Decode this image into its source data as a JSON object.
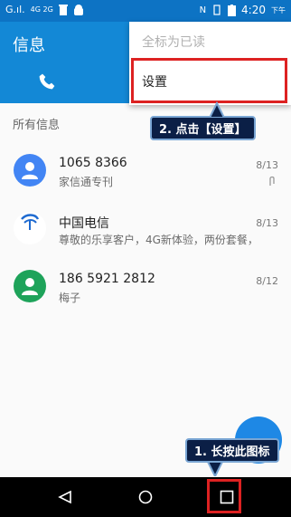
{
  "status_bar": {
    "signal_left": "G.ıl.",
    "network": "4G 2G",
    "time": "4:20",
    "ampm": "下午"
  },
  "app": {
    "title": "信息"
  },
  "section_header": "所有信息",
  "conversations": [
    {
      "name": "1065 8366",
      "preview": "家信通专刊",
      "date": "8/13",
      "avatar_color": "#4285f4",
      "has_attachment": true
    },
    {
      "name": "中国电信",
      "preview": "尊敬的乐享客户，4G新体验，两份套餐，",
      "date": "8/13",
      "avatar_logo_text": "中国电信"
    },
    {
      "name": "186 5921 2812",
      "preview": "梅子",
      "date": "8/12",
      "avatar_color": "#1ea35a"
    }
  ],
  "menu": {
    "items": [
      {
        "label": "全标为已读",
        "enabled": false
      },
      {
        "label": "设置",
        "enabled": true
      }
    ]
  },
  "annotations": {
    "step2": "2. 点击【设置】",
    "step1": "1. 长按此图标"
  },
  "colors": {
    "appbar": "#1388d6",
    "highlight": "#dd2222",
    "callout_bg": "#0b1f46"
  }
}
